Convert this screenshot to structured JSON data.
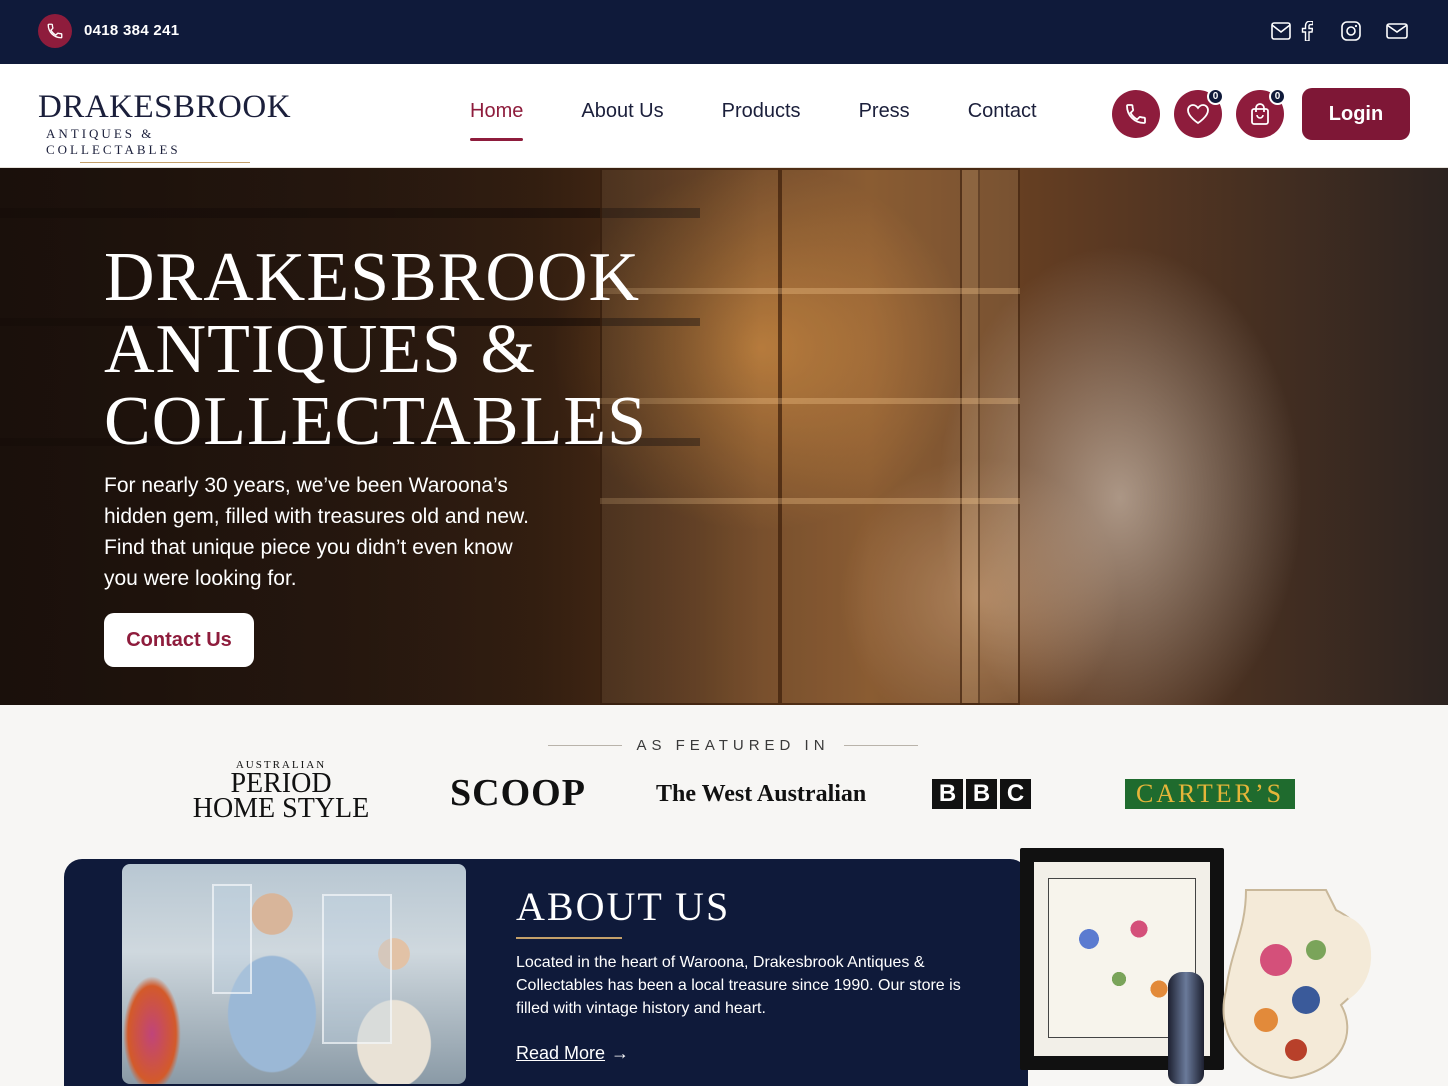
{
  "topbar": {
    "phone": "0418 384 241",
    "icons": [
      "phone-icon",
      "newsletter-icon",
      "facebook-icon",
      "instagram-icon",
      "mail-icon"
    ]
  },
  "logo": {
    "main": "DRAKESBROOK",
    "sub": "ANTIQUES & COLLECTABLES"
  },
  "nav": {
    "items": [
      {
        "label": "Home",
        "active": true
      },
      {
        "label": "About Us",
        "active": false
      },
      {
        "label": "Products",
        "active": false
      },
      {
        "label": "Press",
        "active": false
      },
      {
        "label": "Contact",
        "active": false
      }
    ],
    "wishlist_count": "0",
    "cart_count": "0",
    "login": "Login"
  },
  "hero": {
    "title_line1": "DRAKESBROOK",
    "title_line2": "ANTIQUES &",
    "title_line3": "COLLECTABLES",
    "text": "For nearly 30 years, we’ve been Waroona’s hidden gem, filled with treasures old and new. Find that unique piece you didn’t even know you were looking for.",
    "button": "Contact Us"
  },
  "featured": {
    "label": "AS FEATURED IN",
    "logos": {
      "period_small": "AUSTRALIAN",
      "period_line1": "PERIOD",
      "period_line2": "HOME STYLE",
      "scoop": "SCOOP",
      "west": "The West Australian",
      "bbc": [
        "B",
        "B",
        "C"
      ],
      "carters": "CARTER’S"
    }
  },
  "about": {
    "title": "ABOUT US",
    "text": "Located in the heart of Waroona, Drakesbrook Antiques & Collectables has been a local treasure since 1990. Our store is filled with vintage history and heart.",
    "link": "Read More",
    "arrow": "→"
  },
  "colors": {
    "navy": "#0f1a3a",
    "burgundy": "#8e1c3c",
    "gold": "#c4a06a"
  }
}
